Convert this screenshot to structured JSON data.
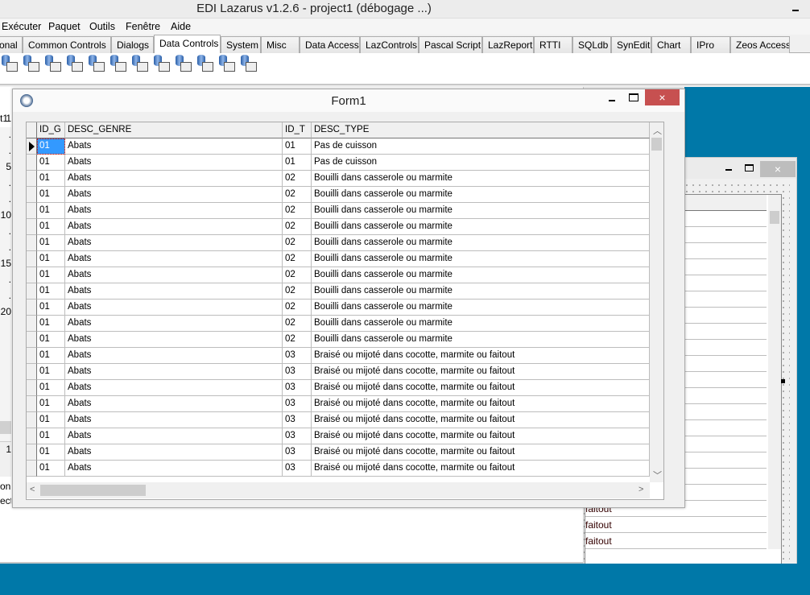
{
  "app": {
    "title": "EDI Lazarus v1.2.6 - project1 (débogage ...)"
  },
  "menu": [
    "Exécuter",
    "Paquet",
    "Outils",
    "Fenêtre",
    "Aide"
  ],
  "tabs": [
    "onal",
    "Common Controls",
    "Dialogs",
    "Data Controls",
    "System",
    "Misc",
    "Data Access",
    "LazControls",
    "Pascal Script",
    "LazReport",
    "RTTI",
    "SQLdb",
    "SynEdit",
    "Chart",
    "IPro",
    "Zeos Access"
  ],
  "active_tab": "Data Controls",
  "palette_icons": [
    "dbtext-icon",
    "dbedit-icon",
    "dbimage-icon",
    "dblistbox-icon",
    "dblookuplistbox-icon",
    "dbcombobox-icon",
    "dblookupcombobox-icon",
    "dbcheckbox-icon",
    "dbradiogroup-icon",
    "dbcalendar-icon",
    "dbgroupbox-icon",
    "dbgrid-icon"
  ],
  "editor": {
    "tab": "t1",
    "gutter": [
      "1",
      ".",
      ".",
      "5",
      ".",
      ".",
      "10",
      ".",
      ".",
      "15",
      ".",
      ".",
      "20"
    ],
    "lower": [
      "1",
      "on",
      "ect"
    ]
  },
  "bgform": {
    "close": "×",
    "cells": [
      "faitout",
      "faitout",
      "faitout"
    ]
  },
  "form1": {
    "title": "Form1",
    "close": "×",
    "columns": [
      "ID_G",
      "DESC_GENRE",
      "ID_T",
      "DESC_TYPE"
    ],
    "rows": [
      [
        "01",
        "Abats",
        "01",
        "Pas de cuisson"
      ],
      [
        "01",
        "Abats",
        "01",
        "Pas de cuisson"
      ],
      [
        "01",
        "Abats",
        "02",
        "Bouilli dans casserole ou marmite"
      ],
      [
        "01",
        "Abats",
        "02",
        "Bouilli dans casserole ou marmite"
      ],
      [
        "01",
        "Abats",
        "02",
        "Bouilli dans casserole ou marmite"
      ],
      [
        "01",
        "Abats",
        "02",
        "Bouilli dans casserole ou marmite"
      ],
      [
        "01",
        "Abats",
        "02",
        "Bouilli dans casserole ou marmite"
      ],
      [
        "01",
        "Abats",
        "02",
        "Bouilli dans casserole ou marmite"
      ],
      [
        "01",
        "Abats",
        "02",
        "Bouilli dans casserole ou marmite"
      ],
      [
        "01",
        "Abats",
        "02",
        "Bouilli dans casserole ou marmite"
      ],
      [
        "01",
        "Abats",
        "02",
        "Bouilli dans casserole ou marmite"
      ],
      [
        "01",
        "Abats",
        "02",
        "Bouilli dans casserole ou marmite"
      ],
      [
        "01",
        "Abats",
        "02",
        "Bouilli dans casserole ou marmite"
      ],
      [
        "01",
        "Abats",
        "03",
        "Braisé ou mijoté dans cocotte, marmite ou faitout"
      ],
      [
        "01",
        "Abats",
        "03",
        "Braisé ou mijoté dans cocotte, marmite ou faitout"
      ],
      [
        "01",
        "Abats",
        "03",
        "Braisé ou mijoté dans cocotte, marmite ou faitout"
      ],
      [
        "01",
        "Abats",
        "03",
        "Braisé ou mijoté dans cocotte, marmite ou faitout"
      ],
      [
        "01",
        "Abats",
        "03",
        "Braisé ou mijoté dans cocotte, marmite ou faitout"
      ],
      [
        "01",
        "Abats",
        "03",
        "Braisé ou mijoté dans cocotte, marmite ou faitout"
      ],
      [
        "01",
        "Abats",
        "03",
        "Braisé ou mijoté dans cocotte, marmite ou faitout"
      ],
      [
        "01",
        "Abats",
        "03",
        "Braisé ou mijoté dans cocotte, marmite ou faitout"
      ]
    ]
  },
  "colors": {
    "desktop": "#0078a8",
    "close_active": "#c75050",
    "selection": "#3399ff"
  }
}
